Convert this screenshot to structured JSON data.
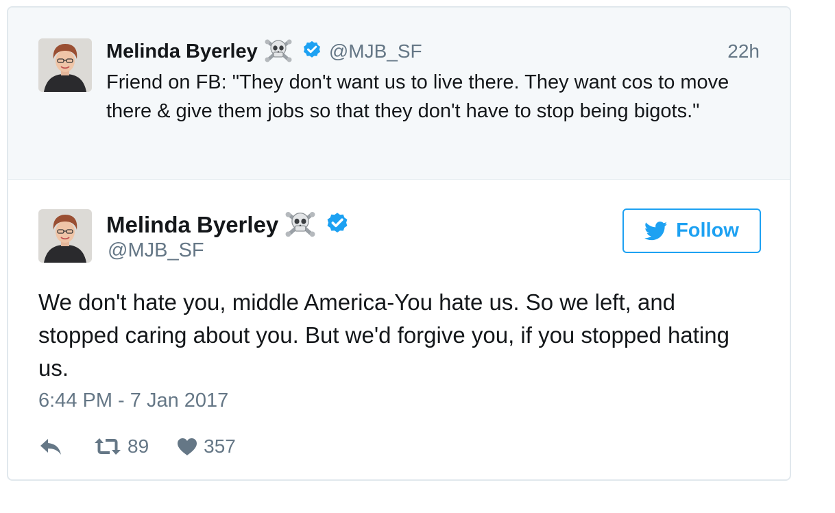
{
  "parent_tweet": {
    "author_name": "Melinda Byerley",
    "name_emoji": "☠",
    "handle": "@MJB_SF",
    "time": "22h",
    "text": "Friend on FB: \"They don't want us to live there. They want cos to move there & give them jobs so that they don't have to stop being bigots.\""
  },
  "main_tweet": {
    "author_name": "Melinda Byerley",
    "name_emoji": "☠",
    "handle": "@MJB_SF",
    "follow_label": "Follow",
    "text": "We don't hate you, middle America-You hate us. So we left, and stopped caring about you. But we'd forgive you, if you stopped hating us.",
    "timestamp": "6:44 PM - 7 Jan 2017",
    "retweet_count": "89",
    "like_count": "357"
  },
  "icons": {
    "verified": "verified-badge-icon",
    "skull": "skull-crossbones-emoji",
    "follow": "twitter-bird-icon",
    "reply": "reply-icon",
    "retweet": "retweet-icon",
    "like": "heart-icon"
  },
  "colors": {
    "accent": "#1da1f2",
    "verified": "#1da1f2",
    "muted_text": "#657786",
    "parent_bg": "#f5f8fa"
  }
}
